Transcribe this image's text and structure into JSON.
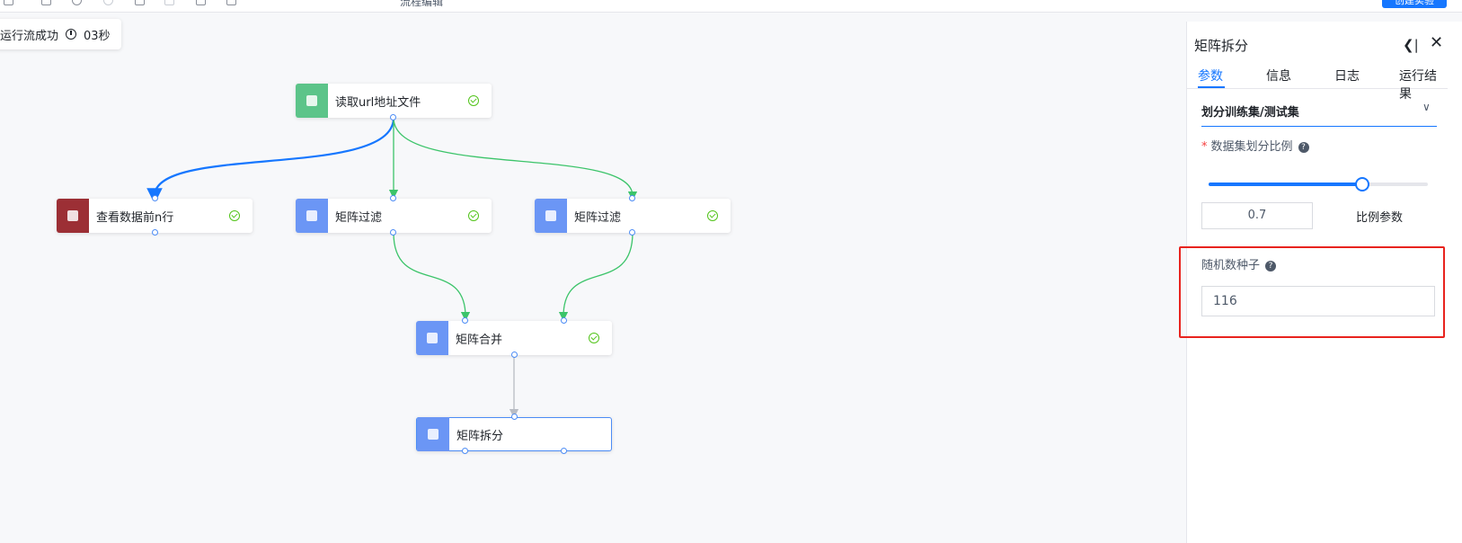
{
  "topbar": {
    "workflow_name": "流程编辑",
    "primary_button": "创建实验"
  },
  "status": {
    "text": "运行流成功",
    "duration": "03秒"
  },
  "nodes": [
    {
      "label": "读取url地址文件",
      "icon": "file-icon",
      "color": "#5cc489",
      "status": "success"
    },
    {
      "label": "查看数据前n行",
      "icon": "table-icon",
      "color": "#9c2f35",
      "status": "success"
    },
    {
      "label": "矩阵过滤",
      "icon": "matrix-icon",
      "color": "#6b96f5",
      "status": "success"
    },
    {
      "label": "矩阵过滤",
      "icon": "matrix-icon",
      "color": "#6b96f5",
      "status": "success"
    },
    {
      "label": "矩阵合并",
      "icon": "matrix-icon",
      "color": "#6b96f5",
      "status": "success"
    },
    {
      "label": "矩阵拆分",
      "icon": "matrix-icon",
      "color": "#6b96f5",
      "status": "selected"
    }
  ],
  "panel": {
    "title": "矩阵拆分",
    "tabs": [
      "参数",
      "信息",
      "日志",
      "运行结果"
    ],
    "active_tab": "参数",
    "section": "划分训练集/测试集",
    "split_ratio_label": "数据集划分比例",
    "split_ratio_required_mark": "*",
    "split_ratio_value": "0.7",
    "split_ratio_fraction": 0.7,
    "ratio_param_label": "比例参数",
    "seed_label": "随机数种子",
    "seed_value": "116"
  },
  "colors": {
    "accent": "#1677ff",
    "success": "#52c41a",
    "edge_green": "#3cc46a",
    "highlight": "#e8231e"
  }
}
